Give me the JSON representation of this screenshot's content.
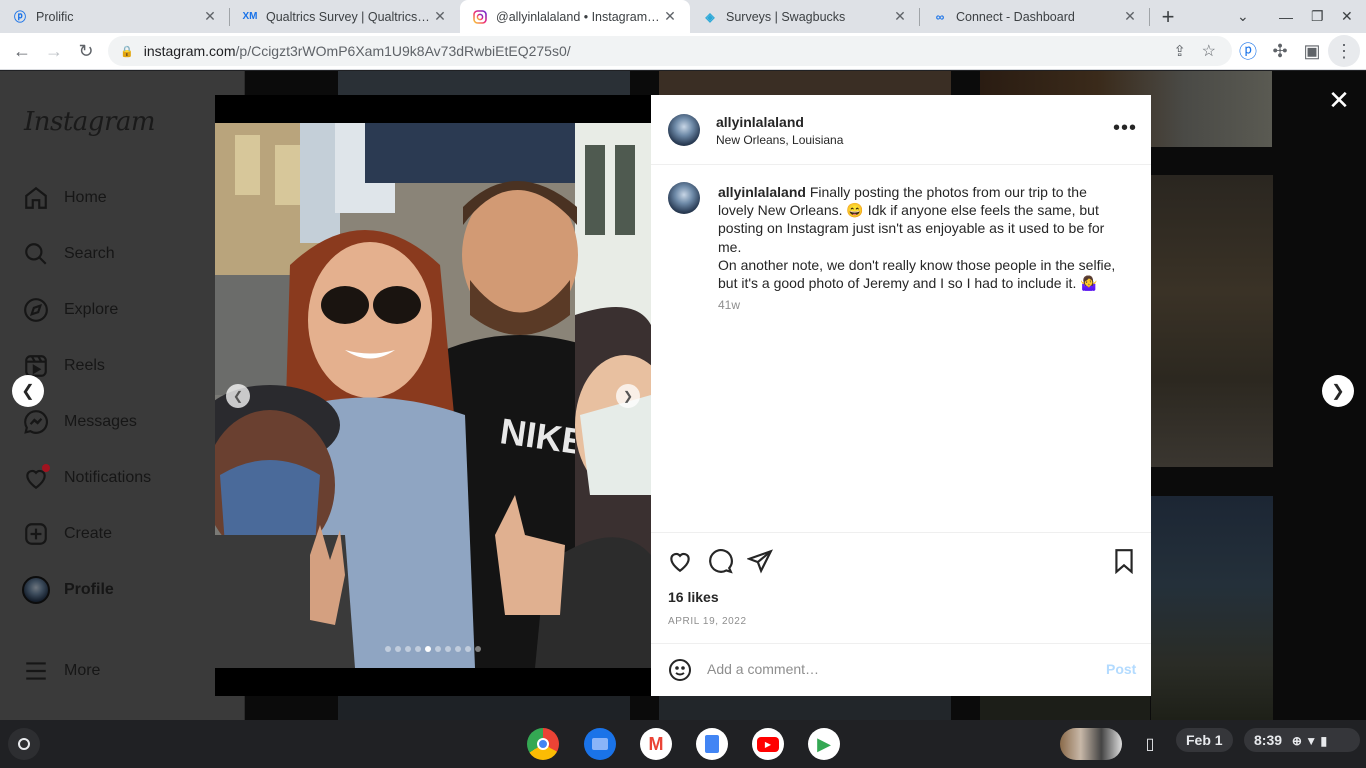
{
  "tabs": [
    {
      "title": "Prolific",
      "favicon": "P",
      "color": "#1a73e8"
    },
    {
      "title": "Qualtrics Survey | Qualtrics Experience Management",
      "favicon": "XM",
      "color": "#1a73e8"
    },
    {
      "title": "@allyinlalaland • Instagram photos and videos",
      "favicon": "ig",
      "color": "#d6249f"
    },
    {
      "title": "Surveys | Swagbucks",
      "favicon": "S",
      "color": "#2aa8d8"
    },
    {
      "title": "Connect - Dashboard",
      "favicon": "∞",
      "color": "#1a73e8"
    }
  ],
  "address": {
    "domain": "instagram.com",
    "path": "/p/Ccigzt3rWOmP6Xam1U9k8Av73dRwbiEtEQ275s0/"
  },
  "sidebar": {
    "logo": "Instagram",
    "items": [
      {
        "label": "Home",
        "icon": "home-icon"
      },
      {
        "label": "Search",
        "icon": "search-icon"
      },
      {
        "label": "Explore",
        "icon": "explore-icon"
      },
      {
        "label": "Reels",
        "icon": "reels-icon"
      },
      {
        "label": "Messages",
        "icon": "messages-icon"
      },
      {
        "label": "Notifications",
        "icon": "heart-icon"
      },
      {
        "label": "Create",
        "icon": "create-icon"
      },
      {
        "label": "Profile",
        "icon": "avatar"
      },
      {
        "label": "More",
        "icon": "menu-icon"
      }
    ]
  },
  "post": {
    "username": "allyinlalaland",
    "location": "New Orleans, Louisiana",
    "caption_user": "allyinlalaland",
    "caption_text": "Finally posting the photos from our trip to the lovely New Orleans. 😄 Idk if anyone else feels the same, but posting on Instagram just isn't as enjoyable as it used to be for me.",
    "caption_text2": "On another note, we don't really know those people in the selfie, but it's a good photo of Jeremy and I so I had to include it. 🤷‍♀️",
    "age": "41w",
    "likes": "16 likes",
    "date": "APRIL 19, 2022",
    "comment_placeholder": "Add a comment…",
    "post_label": "Post",
    "carousel_count": 10,
    "carousel_active": 5
  },
  "shelf": {
    "date": "Feb 1",
    "time": "8:39"
  }
}
